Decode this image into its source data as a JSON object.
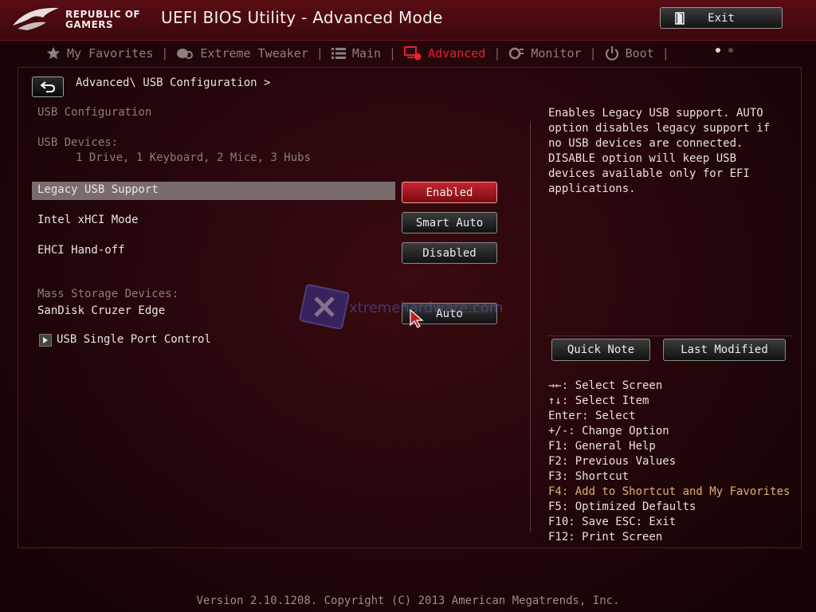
{
  "header": {
    "brand_line1": "REPUBLIC OF",
    "brand_line2": "GAMERS",
    "title": "UEFI BIOS Utility - Advanced Mode",
    "exit_label": "Exit"
  },
  "nav": {
    "tabs": [
      {
        "label": "My Favorites",
        "icon": "star-icon"
      },
      {
        "label": "Extreme Tweaker",
        "icon": "tweaker-icon"
      },
      {
        "label": "Main",
        "icon": "list-icon"
      },
      {
        "label": "Advanced",
        "icon": "advanced-icon",
        "active": true
      },
      {
        "label": "Monitor",
        "icon": "monitor-icon"
      },
      {
        "label": "Boot",
        "icon": "power-icon"
      }
    ]
  },
  "breadcrumb": "Advanced\\ USB Configuration >",
  "main": {
    "section_title": "USB Configuration",
    "devices_label": "USB Devices:",
    "devices_value": "1 Drive, 1 Keyboard, 2 Mice, 3 Hubs",
    "settings": [
      {
        "label": "Legacy USB Support",
        "value": "Enabled",
        "selected": true
      },
      {
        "label": "Intel xHCI Mode",
        "value": "Smart Auto"
      },
      {
        "label": "EHCI Hand-off",
        "value": "Disabled"
      }
    ],
    "mass_storage_label": "Mass Storage Devices:",
    "mass_storage_device": "SanDisk Cruzer Edge",
    "mass_storage_value": "Auto",
    "submenu_label": "USB Single Port Control"
  },
  "help": {
    "text": "Enables Legacy USB support. AUTO option disables legacy support if no USB devices are connected. DISABLE option will keep USB devices available only for EFI applications.",
    "quick_note": "Quick Note",
    "last_modified": "Last Modified"
  },
  "keys": [
    "→←: Select Screen",
    "↑↓: Select Item",
    "Enter: Select",
    "+/-: Change Option",
    "F1: General Help",
    "F2: Previous Values",
    "F3: Shortcut",
    "F4: Add to Shortcut and My Favorites",
    "F5: Optimized Defaults",
    "F10: Save  ESC: Exit",
    "F12: Print Screen"
  ],
  "watermark": "xtremehardware.com",
  "footer": "Version 2.10.1208. Copyright (C) 2013 American Megatrends, Inc.",
  "colors": {
    "accent": "#e0242e",
    "selected_button": "#c4242e",
    "highlight_key": "#e0b070"
  }
}
